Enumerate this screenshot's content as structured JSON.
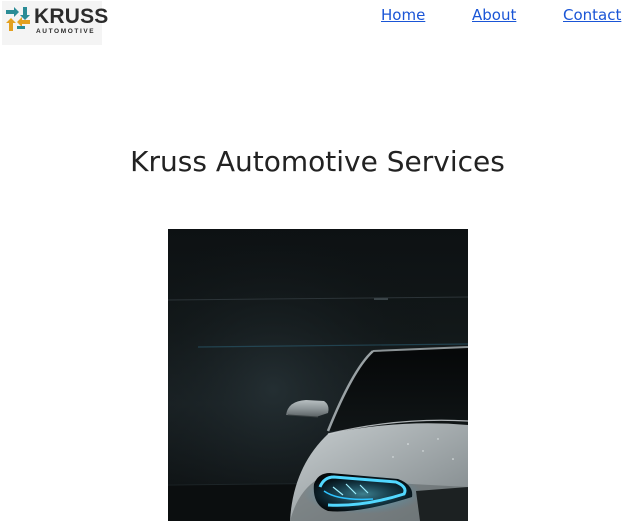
{
  "header": {
    "logo": {
      "word": "KRUSS",
      "subtitle": "AUTOMOTIVE",
      "colors": {
        "teal": "#2a8c96",
        "orange": "#e3a020",
        "dark": "#2b2b2b"
      }
    },
    "nav": [
      {
        "label": "Home"
      },
      {
        "label": "About"
      },
      {
        "label": "Contact"
      }
    ],
    "link_color": "#1a55d6"
  },
  "main": {
    "title": "Kruss Automotive Services",
    "hero_image": {
      "subject": "white sports car with blue LED headlight in dark garage"
    }
  }
}
